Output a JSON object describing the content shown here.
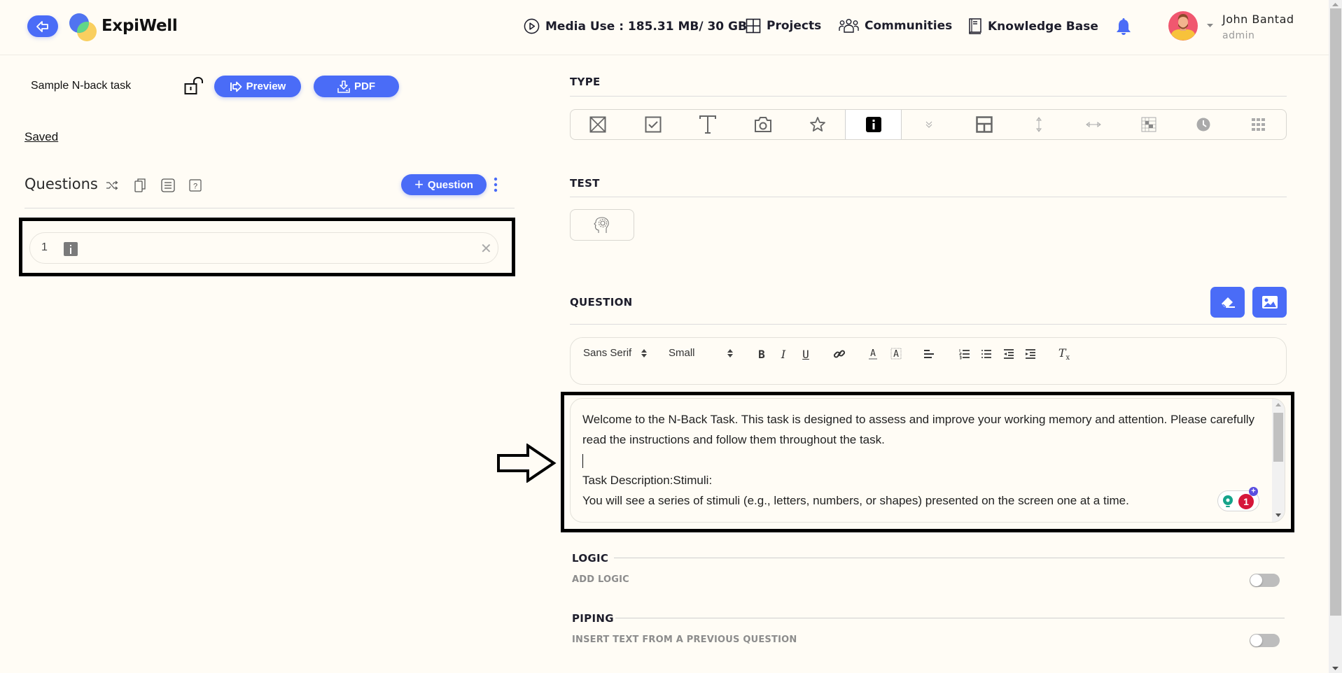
{
  "header": {
    "brand": "ExpiWell",
    "media_use": "Media Use : 185.31 MB/ 30 GB",
    "nav": [
      "Projects",
      "Communities",
      "Knowledge Base"
    ],
    "user": {
      "name": "John Bantad",
      "role": "admin"
    },
    "accent": "#4a6cf7"
  },
  "left": {
    "task_title": "Sample N-back task",
    "preview_label": "Preview",
    "pdf_label": "PDF",
    "saved_label": "Saved",
    "questions_title": "Questions",
    "add_question_label": "Question",
    "questions": [
      {
        "number": "1",
        "type_icon": "info-icon"
      }
    ]
  },
  "right": {
    "type_label": "TYPE",
    "types": [
      {
        "name": "multiple-choice-icon",
        "active": false
      },
      {
        "name": "checkbox-icon",
        "active": false
      },
      {
        "name": "text-icon",
        "active": false
      },
      {
        "name": "camera-icon",
        "active": false
      },
      {
        "name": "star-icon",
        "active": false
      },
      {
        "name": "info-icon",
        "active": true
      },
      {
        "name": "dropdown-icon",
        "active": false
      },
      {
        "name": "layout-icon",
        "active": false
      },
      {
        "name": "vertical-slider-icon",
        "active": false
      },
      {
        "name": "horizontal-slider-icon",
        "active": false
      },
      {
        "name": "matrix-icon",
        "active": false
      },
      {
        "name": "clock-icon",
        "active": false
      },
      {
        "name": "grid-icon",
        "active": false
      }
    ],
    "test_label": "TEST",
    "question_label": "QUESTION",
    "toolbar": {
      "font": "Sans Serif",
      "size": "Small",
      "bold": "B",
      "italic": "I",
      "underline": "U",
      "clear": "Tx"
    },
    "editor_paragraphs": [
      "Welcome to the N-Back Task. This task is designed to assess and improve your working memory and attention. Please carefully read the instructions and follow them throughout the task.",
      "",
      "Task Description:Stimuli:",
      "You will see a series of stimuli (e.g., letters, numbers, or shapes) presented on the screen one at a time."
    ],
    "grammar_badge_count": "1",
    "logic_label": "LOGIC",
    "add_logic_label": "ADD LOGIC",
    "add_logic_enabled": false,
    "piping_label": "PIPING",
    "insert_text_label": "INSERT TEXT FROM A PREVIOUS QUESTION",
    "insert_text_enabled": false
  }
}
